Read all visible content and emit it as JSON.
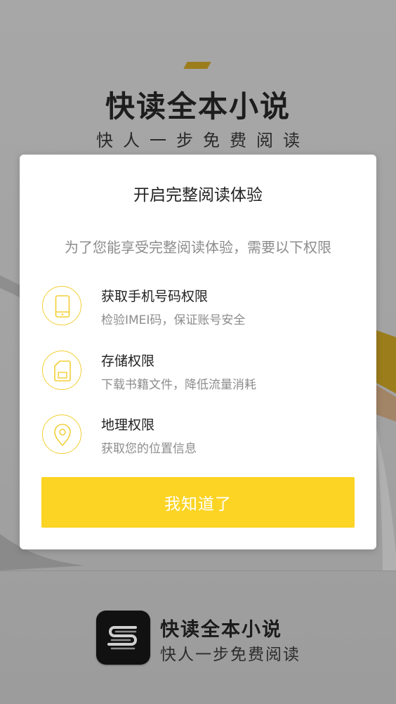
{
  "splash": {
    "title": "快读全本小说",
    "subtitle": "快人一步免费阅读",
    "app_name": "快读全本小说",
    "app_slogan": "快人一步免费阅读"
  },
  "dialog": {
    "title": "开启完整阅读体验",
    "description": "为了您能享受完整阅读体验，需要以下权限",
    "permissions": [
      {
        "icon": "phone-icon",
        "name": "获取手机号码权限",
        "detail": "检验IMEI码，保证账号安全"
      },
      {
        "icon": "sd-card-icon",
        "name": "存储权限",
        "detail": "下载书籍文件，降低流量消耗"
      },
      {
        "icon": "location-pin-icon",
        "name": "地理权限",
        "detail": "获取您的位置信息"
      }
    ],
    "confirm_label": "我知道了"
  },
  "colors": {
    "accent": "#fcd423",
    "icon_outline": "#f3cf36",
    "overlay": "#9a9a9a",
    "brand_dark": "#111111"
  }
}
